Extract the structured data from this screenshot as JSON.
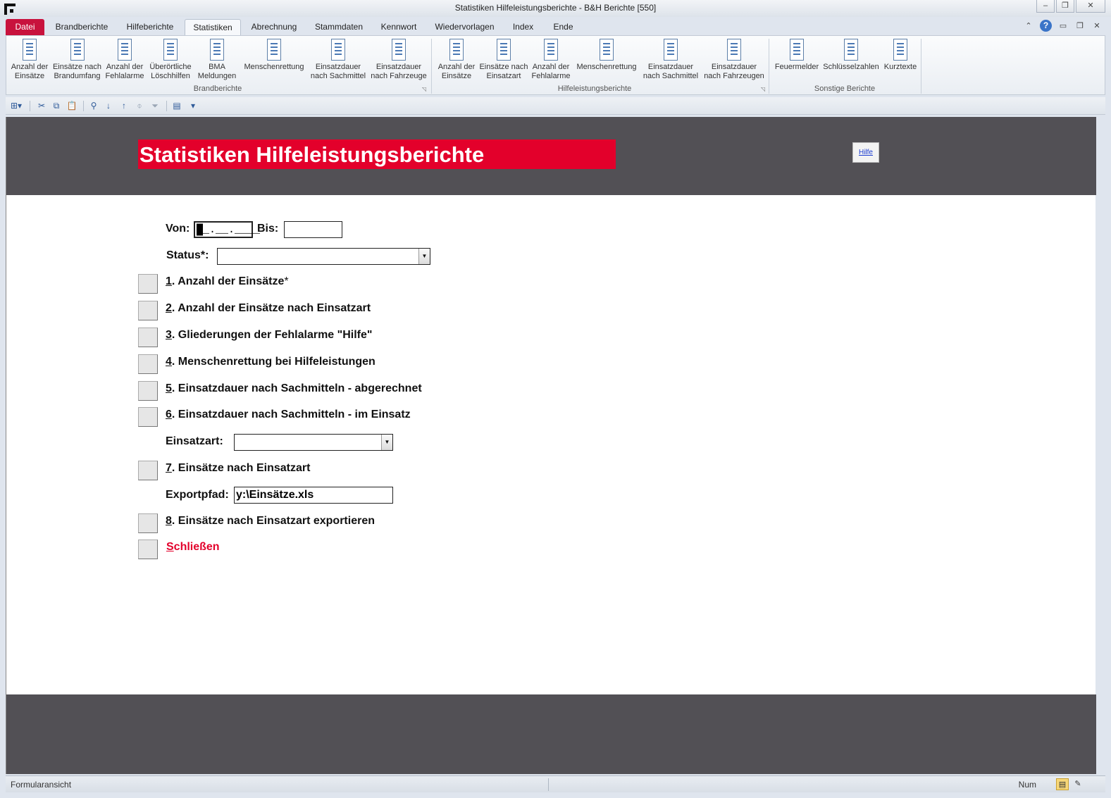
{
  "window": {
    "title": "Statistiken Hilfeleistungsberichte  -  B&H Berichte [550]",
    "minimize": "▭",
    "restore": "◻",
    "close": "✕"
  },
  "ribbon_tabs": [
    "Datei",
    "Brandberichte",
    "Hilfeberichte",
    "Statistiken",
    "Abrechnung",
    "Stammdaten",
    "Kennwort",
    "Wiedervorlagen",
    "Index",
    "Ende"
  ],
  "active_tab": "Statistiken",
  "ribbon": {
    "groups": [
      {
        "label": "Brandberichte",
        "items": [
          [
            "Anzahl der",
            "Einsätze"
          ],
          [
            "Einsätze nach",
            "Brandumfang"
          ],
          [
            "Anzahl der",
            "Fehlalarme"
          ],
          [
            "Überörtliche",
            "Löschhilfen"
          ],
          [
            "BMA",
            "Meldungen"
          ],
          [
            "Menschenrettung",
            ""
          ],
          [
            "Einsatzdauer",
            "nach Sachmittel"
          ],
          [
            "Einsatzdauer",
            "nach Fahrzeuge"
          ]
        ]
      },
      {
        "label": "Hilfeleistungsberichte",
        "items": [
          [
            "Anzahl der",
            "Einsätze"
          ],
          [
            "Einsätze nach",
            "Einsatzart"
          ],
          [
            "Anzahl der",
            "Fehlalarme"
          ],
          [
            "Menschenrettung",
            ""
          ],
          [
            "Einsatzdauer",
            "nach Sachmittel"
          ],
          [
            "Einsatzdauer",
            "nach Fahrzeugen"
          ]
        ]
      },
      {
        "label": "Sonstige Berichte",
        "items": [
          [
            "Feuermelder",
            ""
          ],
          [
            "Schlüsselzahlen",
            ""
          ],
          [
            "Kurztexte",
            ""
          ]
        ]
      }
    ]
  },
  "form": {
    "title": "Statistiken Hilfeleistungsberichte",
    "help_button": "Hilfe",
    "von_label": "Von:",
    "von_value": "█_.__.____",
    "bis_label": "Bis:",
    "bis_value": "",
    "status_label": "Status*:",
    "status_value": "",
    "einsatzart_label": "Einsatzart:",
    "einsatzart_value": "",
    "exportpfad_label": "Exportpfad:",
    "exportpfad_value": "y:\\Einsätze.xls",
    "reports": [
      {
        "num": "1",
        "text": ". Anzahl der Einsätze",
        "suffix": "*"
      },
      {
        "num": "2",
        "text": ". Anzahl der Einsätze nach Einsatzart",
        "suffix": ""
      },
      {
        "num": "3",
        "text": ". Gliederungen der Fehlalarme \"Hilfe\"",
        "suffix": ""
      },
      {
        "num": "4",
        "text": ". Menschenrettung bei Hilfeleistungen",
        "suffix": ""
      },
      {
        "num": "5",
        "text": ". Einsatzdauer nach Sachmitteln - abgerechnet",
        "suffix": ""
      },
      {
        "num": "6",
        "text": ". Einsatzdauer nach Sachmitteln - im Einsatz",
        "suffix": ""
      },
      {
        "num": "7",
        "text": ". Einsätze nach Einsatzart",
        "suffix": ""
      },
      {
        "num": "8",
        "text": ". Einsätze nach Einsatzart exportieren",
        "suffix": ""
      }
    ],
    "close_first": "S",
    "close_rest": "chließen"
  },
  "statusbar": {
    "view": "Formularansicht",
    "num": "Num"
  },
  "colors": {
    "accent_red": "#e3002b",
    "band_gray": "#525055",
    "datei_tab": "#c8123d"
  }
}
